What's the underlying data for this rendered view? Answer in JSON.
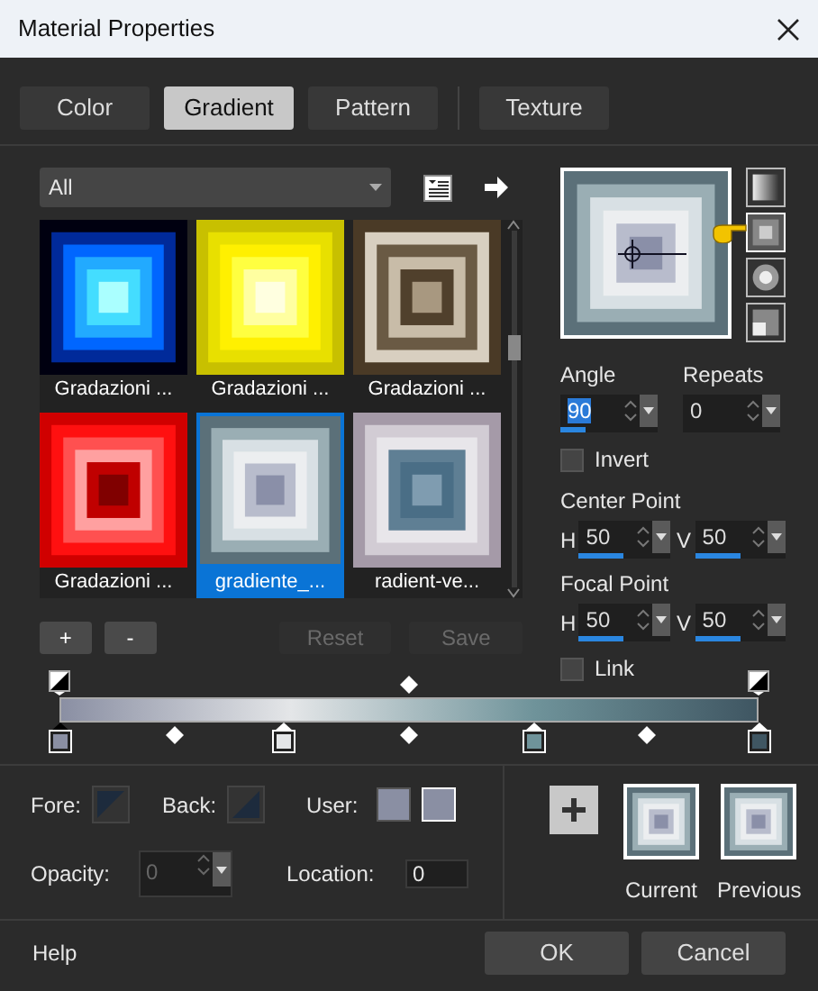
{
  "window": {
    "title": "Material Properties"
  },
  "tabs": [
    {
      "label": "Color",
      "selected": false
    },
    {
      "label": "Gradient",
      "selected": true
    },
    {
      "label": "Pattern",
      "selected": false
    },
    {
      "label": "Texture",
      "selected": false
    }
  ],
  "category": {
    "value": "All"
  },
  "gradients": [
    {
      "name": "Gradazioni ...",
      "selected": false
    },
    {
      "name": "Gradazioni ...",
      "selected": false
    },
    {
      "name": "Gradazioni ...",
      "selected": false
    },
    {
      "name": "Gradazioni ...",
      "selected": false
    },
    {
      "name": "gradiente_...",
      "selected": true
    },
    {
      "name": "radient-ve...",
      "selected": false
    }
  ],
  "list_buttons": [
    {
      "label": "+",
      "disabled": false
    },
    {
      "label": "-",
      "disabled": false
    },
    {
      "label": "Reset",
      "disabled": true
    },
    {
      "label": "Save",
      "disabled": true
    }
  ],
  "styles": [
    {
      "selected": false
    },
    {
      "selected": true
    },
    {
      "selected": false
    },
    {
      "selected": false
    }
  ],
  "angle": {
    "label": "Angle",
    "value": "90",
    "level": 0.25
  },
  "repeats": {
    "label": "Repeats",
    "value": "0"
  },
  "invert": {
    "label": "Invert",
    "checked": false
  },
  "center_point": {
    "label": "Center Point",
    "h": {
      "label": "H",
      "value": "50",
      "level": 0.5
    },
    "v": {
      "label": "V",
      "value": "50",
      "level": 0.5
    }
  },
  "focal_point": {
    "label": "Focal Point",
    "h": {
      "label": "H",
      "value": "50",
      "level": 0.5
    },
    "v": {
      "label": "V",
      "value": "50",
      "level": 0.5
    }
  },
  "link": {
    "label": "Link",
    "checked": false
  },
  "stops": [
    {
      "color": "#8a8fa3"
    },
    {
      "color": "#e4e6e8"
    },
    {
      "color": "#6f939a"
    },
    {
      "color": "#3f5662"
    }
  ],
  "fore_label": "Fore:",
  "back_label": "Back:",
  "user_label": "User:",
  "opacity": {
    "label": "Opacity:",
    "value": "0"
  },
  "location": {
    "label": "Location:",
    "value": "0"
  },
  "swatches": [
    {
      "label": "Current"
    },
    {
      "label": "Previous"
    }
  ],
  "buttons": {
    "help": "Help",
    "ok": "OK",
    "cancel": "Cancel"
  }
}
